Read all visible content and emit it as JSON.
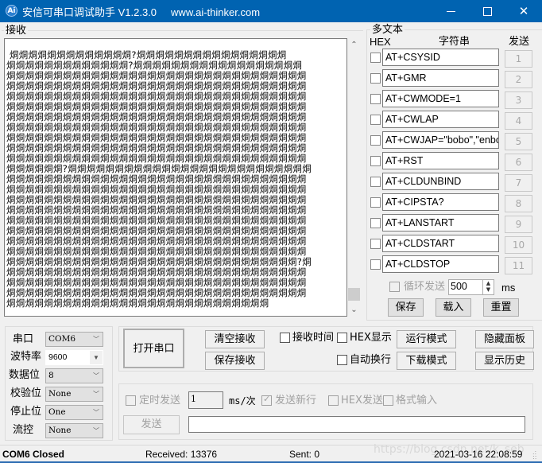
{
  "window": {
    "icon": "ai-thinker-logo-icon",
    "title": "安信可串口调试助手 V1.2.3.0",
    "url": "www.ai-thinker.com",
    "minimize": "minimize-icon",
    "maximize": "maximize-icon",
    "close": "close-icon"
  },
  "receive": {
    "label": "接收",
    "lines": [
      " 烔烔烔烔烔烔烔烔烔烔烔烔烔?烔烔烔烔烔烔烔烔烔烔烔烔烔烔烔烔",
      "烔烔烔烔烔烔烔烔烔烔烔烔烔?烔烔烔烔烔烔烔烔烔烔烔烔烔烔烔烔烔烔",
      "烔烔烔烔烔烔烔烔烔烔烔烔烔烔烔烔烔烔烔烔烔烔烔烔烔烔烔烔烔烔烔烔",
      "烔烔烔烔烔烔烔烔烔烔烔烔烔烔烔烔烔烔烔烔烔烔烔烔烔烔烔烔烔烔烔烔",
      "烔烔烔烔烔烔烔烔烔烔烔烔烔烔烔烔烔烔烔烔烔烔烔烔烔烔烔烔烔烔烔烔",
      "烔烔烔烔烔烔烔烔烔烔烔烔烔烔烔烔烔烔烔烔烔烔烔烔烔烔烔烔烔烔烔烔",
      "烔烔烔烔烔烔烔烔烔烔烔烔烔烔烔烔烔烔烔烔烔烔烔烔烔烔烔烔烔烔烔烔",
      "烔烔烔烔烔烔烔烔烔烔烔烔烔烔烔烔烔烔烔烔烔烔烔烔烔烔烔烔烔烔烔烔",
      "烔烔烔烔烔烔烔烔烔烔烔烔烔烔烔烔烔烔烔烔烔烔烔烔烔烔烔烔烔烔烔烔",
      "烔烔烔烔烔烔烔烔烔烔烔烔烔烔烔烔烔烔烔烔烔烔烔烔烔烔烔烔烔烔烔烔",
      "烔烔烔烔烔烔烔烔烔烔烔烔烔烔烔烔烔烔烔烔烔烔烔烔烔烔烔烔烔烔烔烔",
      "烔烔烔烔烔烔?烔烔烔烔烔烔烔烔烔烔烔烔烔烔烔烔烔烔烔烔烔烔烔烔烔烔",
      "烔烔烔烔烔烔烔烔烔烔烔烔烔烔烔烔烔烔烔烔烔烔烔烔烔烔烔烔烔烔烔烔",
      "烔烔烔烔烔烔烔烔烔烔烔烔烔烔烔烔烔烔烔烔烔烔烔烔烔烔烔烔烔烔烔烔",
      "烔烔烔烔烔烔烔烔烔烔烔烔烔烔烔烔烔烔烔烔烔烔烔烔烔烔烔烔烔烔烔烔",
      "烔烔烔烔烔烔烔烔烔烔烔烔烔烔烔烔烔烔烔烔烔烔烔烔烔烔烔烔烔烔烔烔",
      "烔烔烔烔烔烔烔烔烔烔烔烔烔烔烔烔烔烔烔烔烔烔烔烔烔烔烔烔烔烔烔烔",
      "烔烔烔烔烔烔烔烔烔烔烔烔烔烔烔烔烔烔烔烔烔烔烔烔烔烔烔烔烔烔烔烔",
      "烔烔烔烔烔烔烔烔烔烔烔烔烔烔烔烔烔烔烔烔烔烔烔烔烔烔烔烔烔烔烔烔",
      "烔烔烔烔烔烔烔烔烔烔烔烔烔烔烔烔烔烔烔烔烔烔烔烔烔烔烔烔烔烔烔烔",
      "烔烔烔烔烔烔烔烔烔烔烔烔烔烔烔烔烔烔烔烔烔烔烔烔烔烔烔烔烔烔烔?烔",
      "烔烔烔烔烔烔烔烔烔烔烔烔烔烔烔烔烔烔烔烔烔烔烔烔烔烔烔烔烔烔烔烔",
      "烔烔烔烔烔烔烔烔烔烔烔烔烔烔烔烔烔烔烔烔烔烔烔烔烔烔烔烔烔烔烔烔",
      "烔烔烔烔烔烔烔烔烔烔烔烔烔烔烔烔烔烔烔烔烔烔烔烔烔烔烔烔烔烔烔烔",
      "烔烔烔烔烔烔烔烔烔烔烔烔烔烔烔烔烔烔烔烔烔烔烔烔烔烔烔烔"
    ]
  },
  "multitext": {
    "label": "多文本",
    "col_hex": "HEX",
    "col_string": "字符串",
    "col_send": "发送",
    "rows": [
      {
        "hex": false,
        "value": "AT+CSYSID",
        "send": "1"
      },
      {
        "hex": false,
        "value": "AT+GMR",
        "send": "2"
      },
      {
        "hex": false,
        "value": "AT+CWMODE=1",
        "send": "3"
      },
      {
        "hex": false,
        "value": "AT+CWLAP",
        "send": "4"
      },
      {
        "hex": false,
        "value": "AT+CWJAP=\"bobo\",\"enbo",
        "send": "5"
      },
      {
        "hex": false,
        "value": "AT+RST",
        "send": "6"
      },
      {
        "hex": false,
        "value": "AT+CLDUNBIND",
        "send": "7"
      },
      {
        "hex": false,
        "value": "AT+CIPSTA?",
        "send": "8"
      },
      {
        "hex": false,
        "value": "AT+LANSTART",
        "send": "9"
      },
      {
        "hex": false,
        "value": "AT+CLDSTART",
        "send": "10"
      },
      {
        "hex": false,
        "value": "AT+CLDSTOP",
        "send": "11"
      }
    ],
    "loop_send_label": "循环发送",
    "loop_send_checked": false,
    "loop_interval": "500",
    "loop_unit": "ms",
    "save": "保存",
    "load": "载入",
    "reset": "重置"
  },
  "port_settings": {
    "port_label": "串口",
    "port_value": "COM6",
    "baud_label": "波特率",
    "baud_value": "9600",
    "databits_label": "数据位",
    "databits_value": "8",
    "parity_label": "校验位",
    "parity_value": "None",
    "stopbits_label": "停止位",
    "stopbits_value": "One",
    "flow_label": "流控",
    "flow_value": "None"
  },
  "controls": {
    "open_port": "打开串口",
    "clear_receive": "清空接收",
    "save_receive": "保存接收",
    "receive_time": "接收时间",
    "receive_time_checked": false,
    "hex_display": "HEX显示",
    "hex_display_checked": false,
    "auto_newline": "自动换行",
    "auto_newline_checked": false,
    "run_mode": "运行模式",
    "download_mode": "下载模式",
    "hide_panel": "隐藏面板",
    "show_history": "显示历史"
  },
  "send_area": {
    "timed_send": "定时发送",
    "timed_send_checked": false,
    "interval_value": "1",
    "interval_unit": "ms/次",
    "send_newline": "发送新行",
    "send_newline_checked": true,
    "hex_send": "HEX发送",
    "hex_send_checked": false,
    "format_input": "格式输入",
    "format_input_checked": false,
    "send_button": "发送",
    "send_input_value": ""
  },
  "statusbar": {
    "port_status": "COM6 Closed",
    "received": "Received: 13376",
    "sent": "Sent: 0",
    "datetime": "2021-03-16 22:08:59",
    "watermark": "https://blog.csdn.net/k_seb"
  }
}
